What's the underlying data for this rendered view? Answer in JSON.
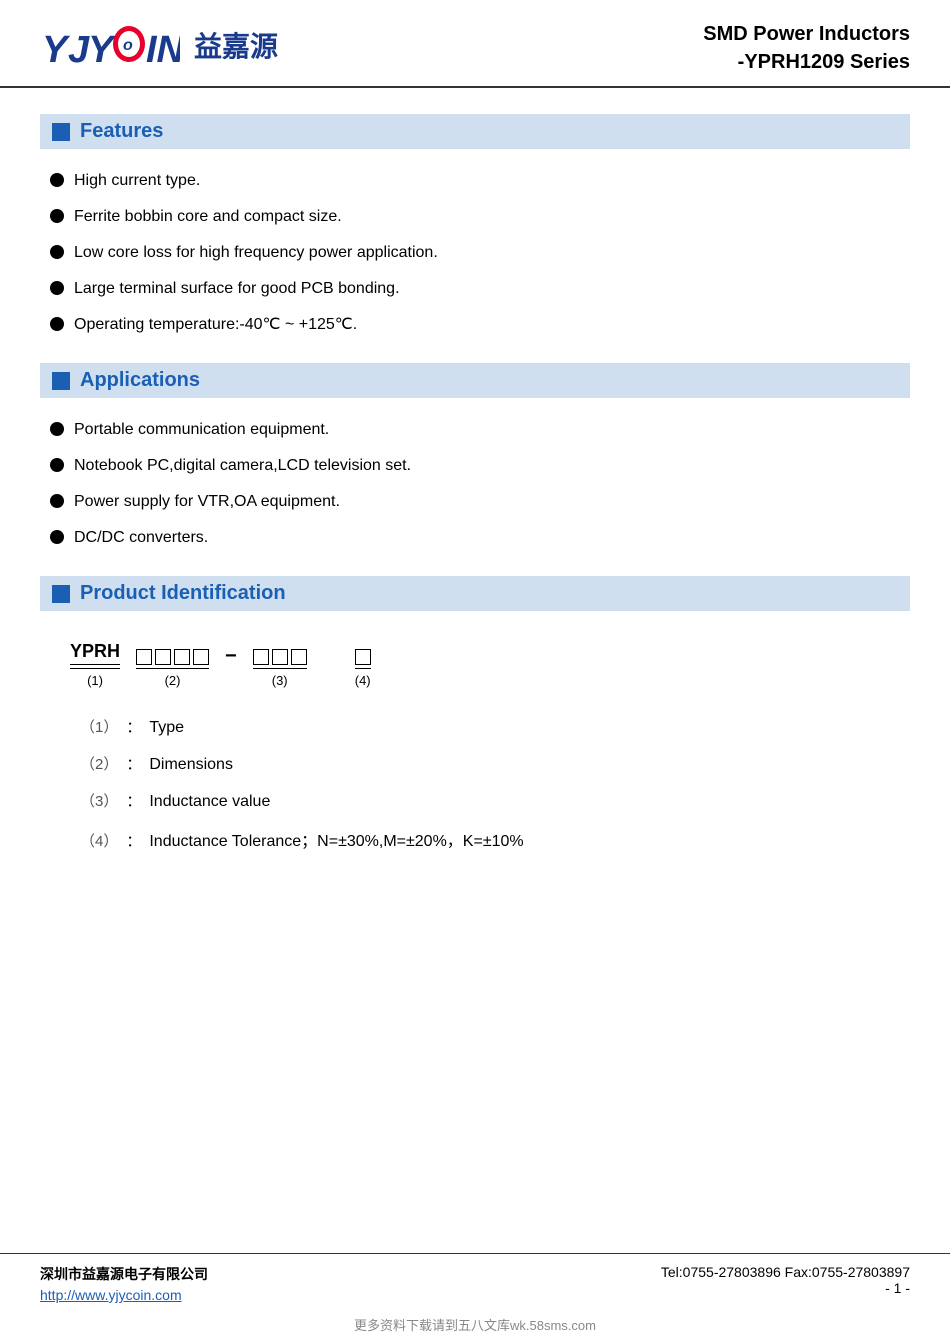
{
  "header": {
    "logo_text_yjy": "YJYC",
    "logo_text_coin": "OIN",
    "logo_chinese": "益嘉源",
    "title_line1": "SMD Power Inductors",
    "title_line2": "-YPRH1209 Series"
  },
  "features": {
    "section_label": "Features",
    "items": [
      "High current type.",
      "Ferrite bobbin core and compact size.",
      "Low core loss for high frequency power application.",
      "Large terminal surface for good PCB bonding.",
      "Operating temperature:-40℃  ~ +125℃."
    ]
  },
  "applications": {
    "section_label": "Applications",
    "items": [
      "Portable communication equipment.",
      "Notebook PC,digital camera,LCD television set.",
      "Power supply for VTR,OA equipment.",
      "DC/DC converters."
    ]
  },
  "product_identification": {
    "section_label": "Product Identification",
    "prefix": "YPRH",
    "label1": "(1)",
    "label2": "(2)",
    "label3": "(3)",
    "label4": "(4)",
    "desc1_num": "（1）",
    "desc1_colon": "：",
    "desc1_text": "Type",
    "desc2_num": "（2）",
    "desc2_colon": "：",
    "desc2_text": "Dimensions",
    "desc3_num": "（3）",
    "desc3_colon": "：",
    "desc3_text": "Inductance value",
    "desc4_num": "（4）",
    "desc4_colon": "：",
    "desc4_text": "Inductance Tolerance；N=±30%,M=±20%，K=±10%"
  },
  "footer": {
    "company": "深圳市益嘉源电子有限公司",
    "url": "http://www.yjycoin.com",
    "tel_fax": "Tel:0755-27803896   Fax:0755-27803897",
    "page": "- 1 -",
    "watermark": "更多资料下载请到五八文库wk.58sms.com"
  },
  "colors": {
    "accent_blue": "#1a5fb4",
    "section_bg": "#d0dff0",
    "logo_blue": "#1a3a8c",
    "logo_red": "#e8002d"
  }
}
